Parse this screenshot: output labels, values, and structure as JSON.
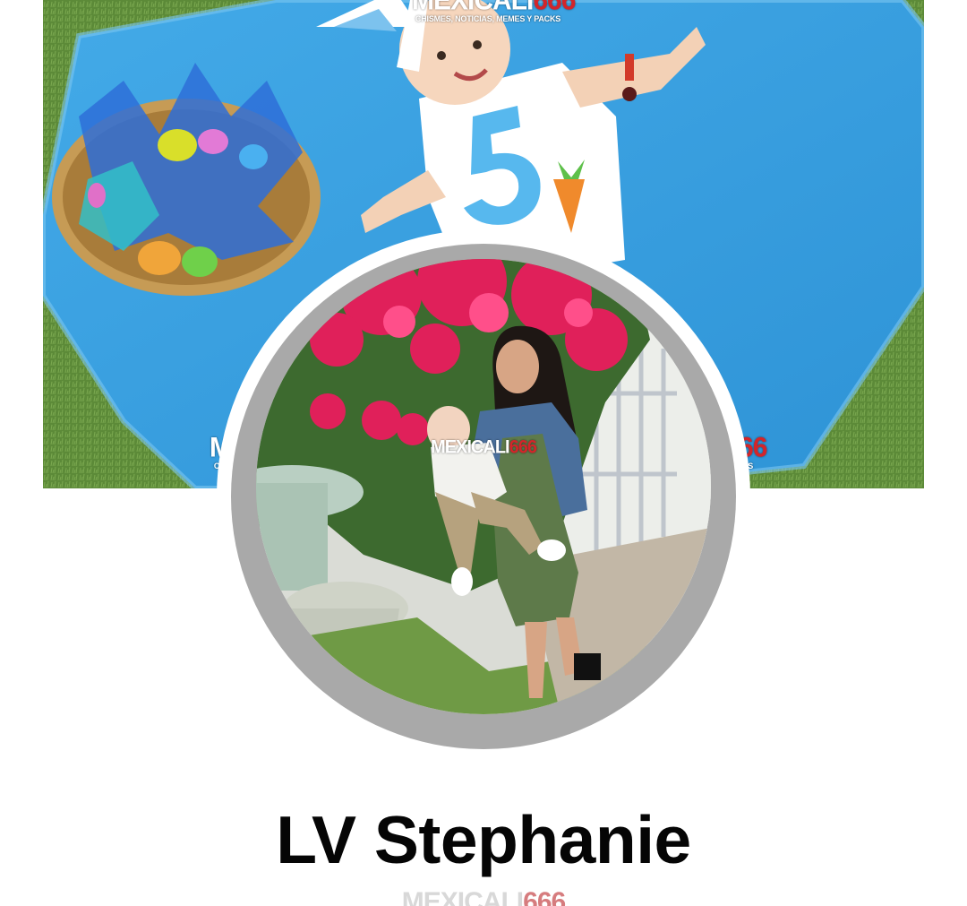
{
  "profile": {
    "name": "LV Stephanie"
  },
  "watermark": {
    "main": "MEXICALI",
    "number": "666",
    "tagline": "CHISMES, NOTICIAS, MEMES Y PACKS"
  },
  "images": {
    "cover_photo": "baby-on-blue-blanket-with-easter-basket",
    "profile_photo": "woman-holding-baby-in-front-of-flowers"
  },
  "colors": {
    "name_text": "#050505",
    "avatar_border": "#a9a9a9",
    "blanket": "#3aa0e0",
    "grass": "#5f8a3c",
    "watermark_red": "#d3252a"
  }
}
